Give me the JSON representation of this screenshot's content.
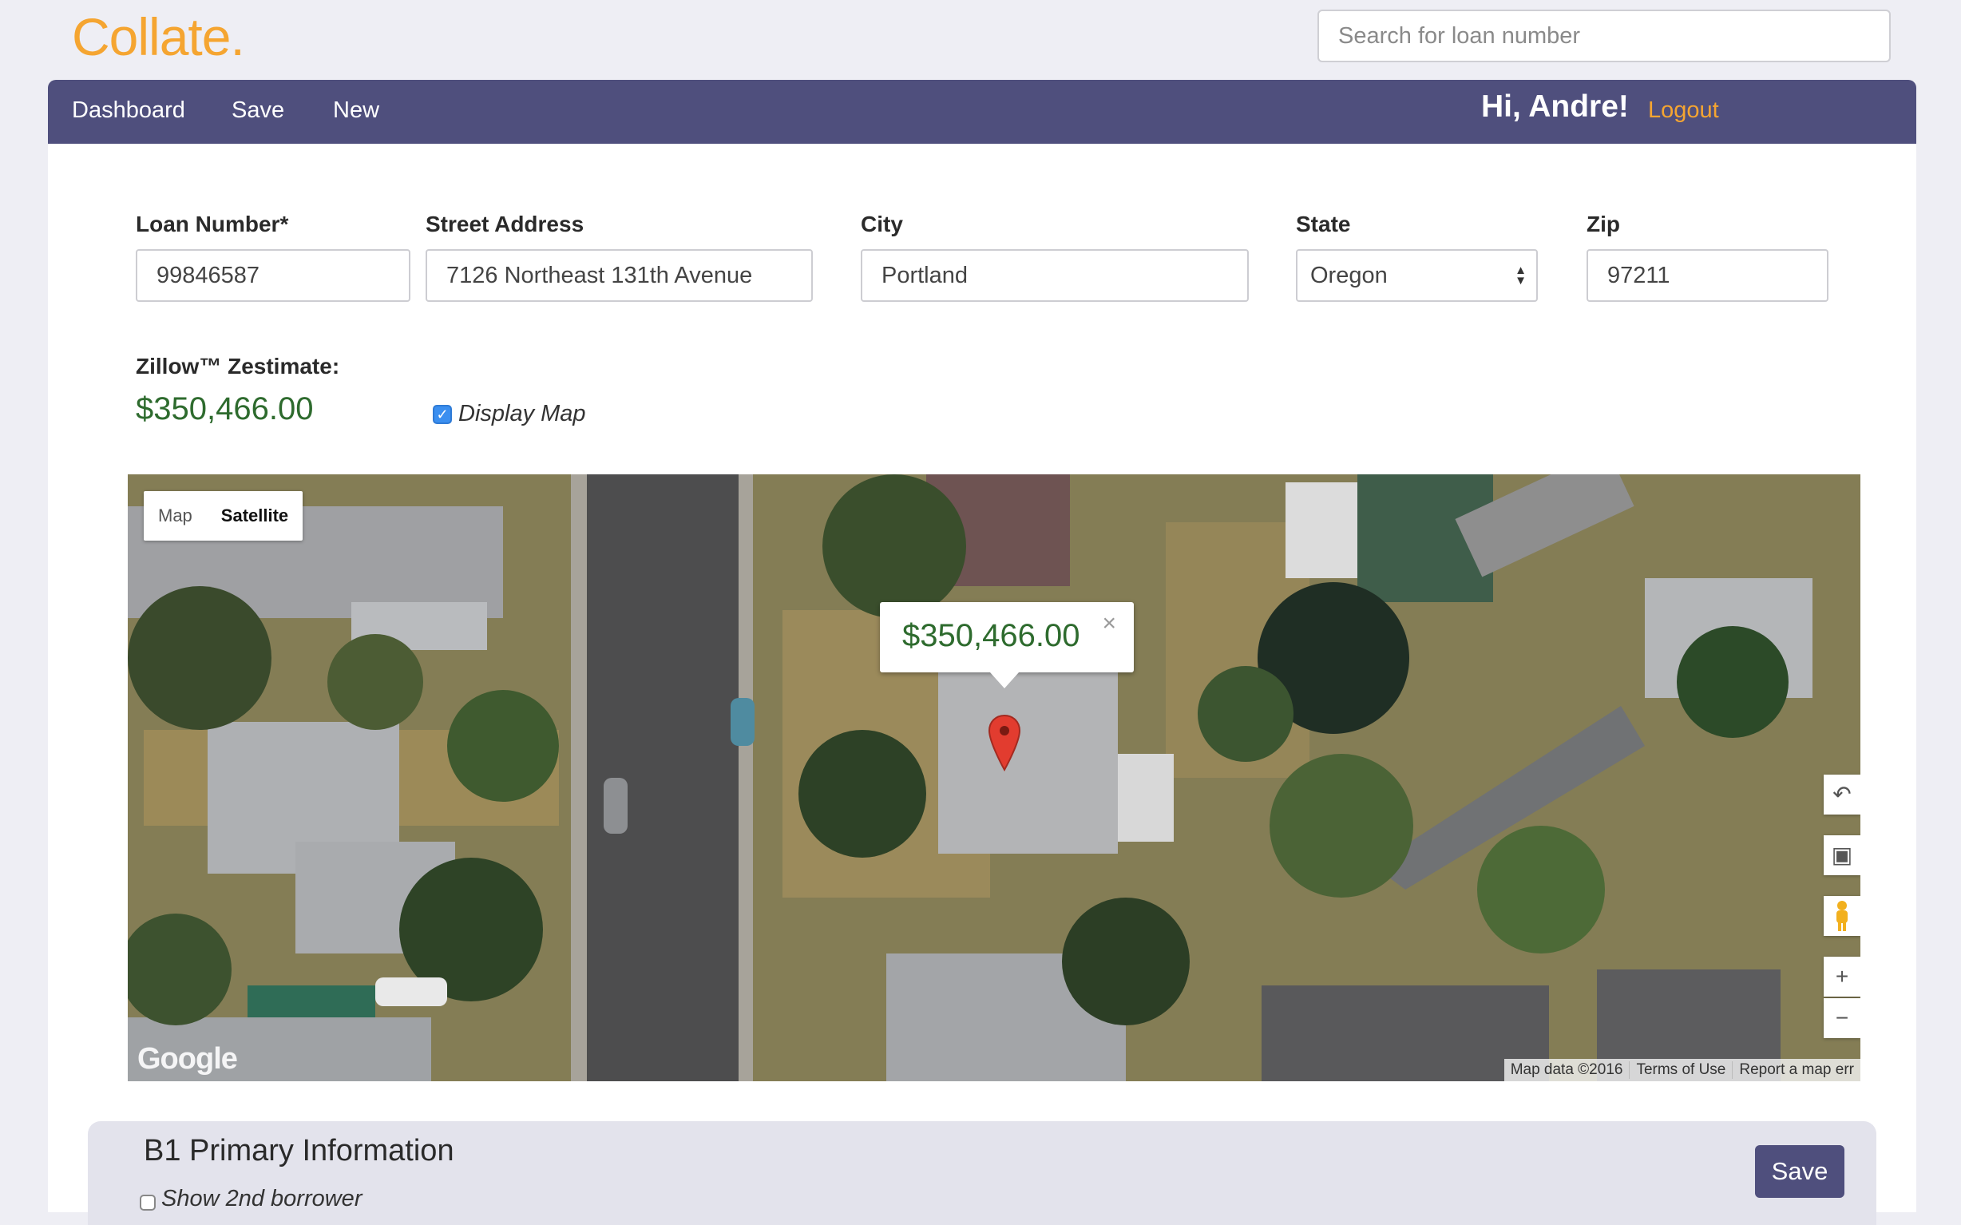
{
  "app": {
    "logo": "Collate."
  },
  "search": {
    "placeholder": "Search for loan number"
  },
  "nav": {
    "items": [
      "Dashboard",
      "Save",
      "New"
    ],
    "greeting": "Hi, Andre!",
    "logout": "Logout"
  },
  "form": {
    "loan_number": {
      "label": "Loan Number*",
      "value": "99846587"
    },
    "street": {
      "label": "Street Address",
      "value": "7126 Northeast 131th Avenue"
    },
    "city": {
      "label": "City",
      "value": "Portland"
    },
    "state": {
      "label": "State",
      "value": "Oregon"
    },
    "zip": {
      "label": "Zip",
      "value": "97211"
    }
  },
  "zestimate": {
    "label": "Zillow™ Zestimate:",
    "value": "$350,466.00",
    "display_map": {
      "label": "Display Map",
      "checked": true
    }
  },
  "map": {
    "view": "satellite",
    "type_buttons": {
      "map": "Map",
      "satellite": "Satellite",
      "selected": "Satellite"
    },
    "infowindow_price": "$350,466.00",
    "infowindow_close": "×",
    "controls": {
      "zoom_in": "+",
      "zoom_out": "−"
    },
    "attribution": [
      "Map data ©2016",
      "Terms of Use",
      "Report a map err"
    ],
    "watermark": "Google",
    "marker_color": "#e23c2f"
  },
  "section": {
    "title": "B1 Primary Information",
    "save": "Save",
    "show_second_borrower": {
      "label": "Show 2nd borrower",
      "checked": false
    }
  },
  "colors": {
    "accent": "#f5a531",
    "navbar": "#4f4f7d",
    "money": "#2e6b2e",
    "checkbox": "#3b8ff0"
  }
}
